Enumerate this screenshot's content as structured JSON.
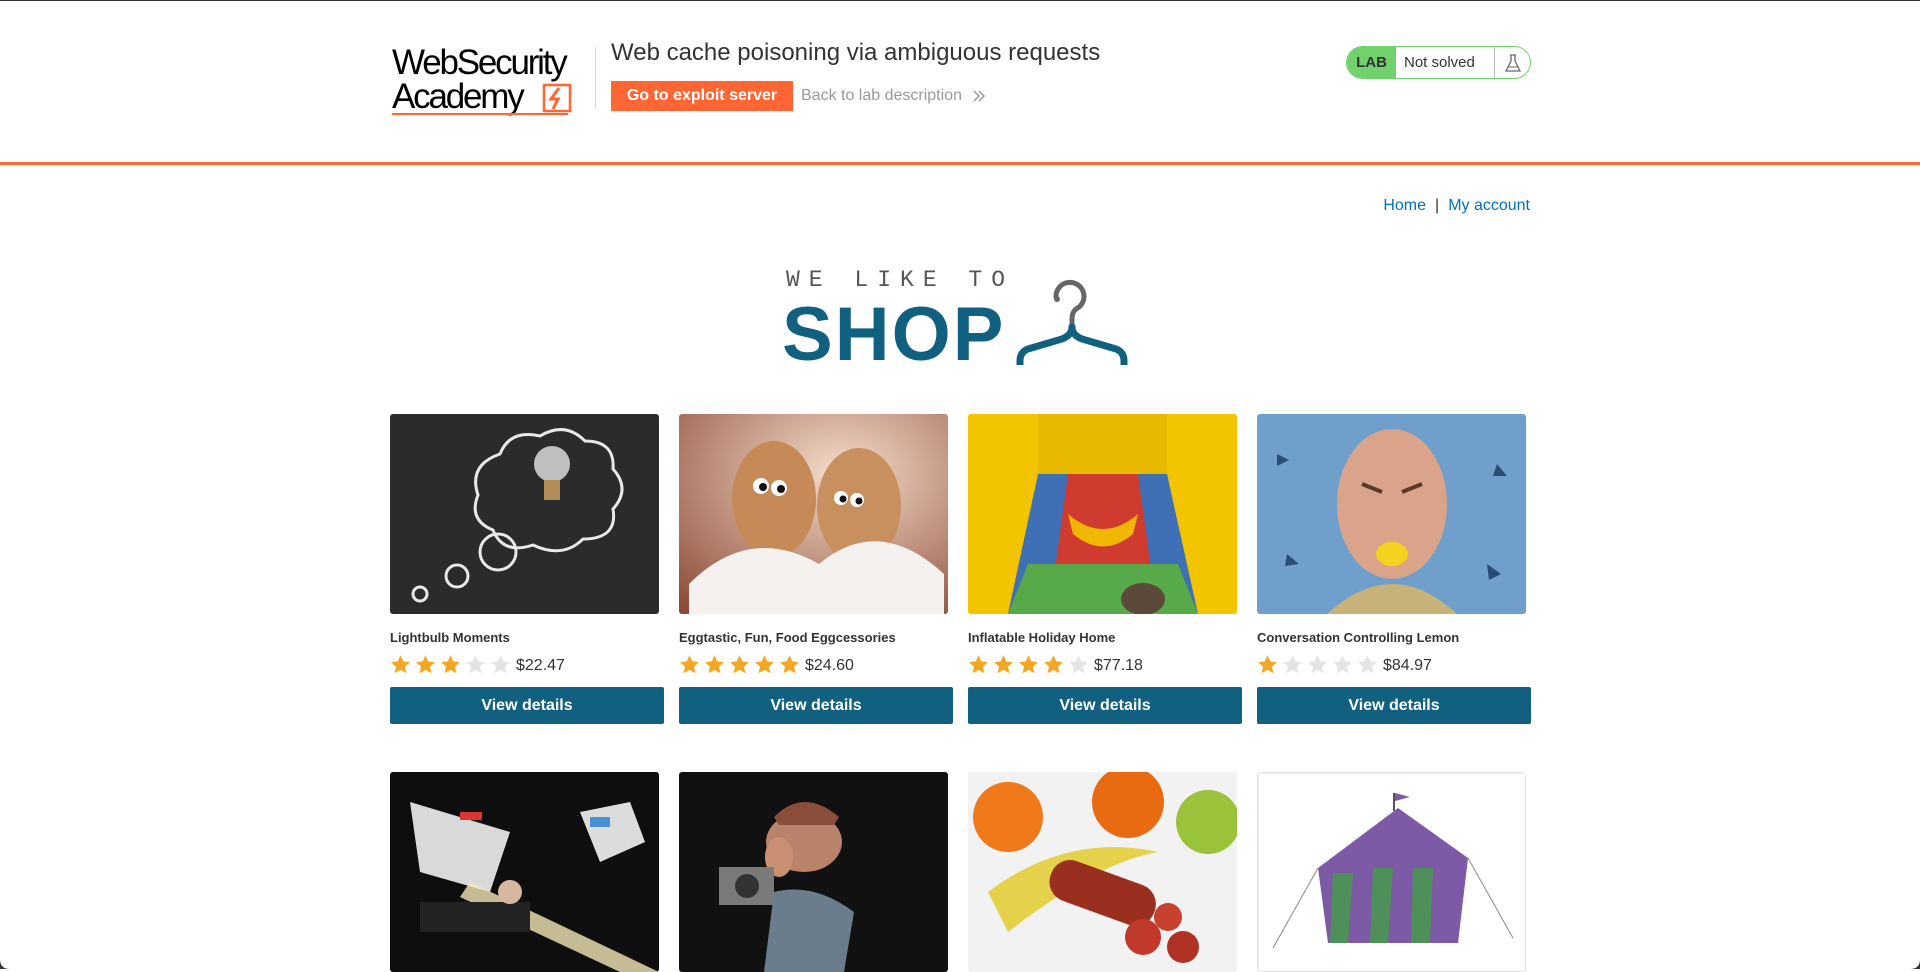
{
  "header": {
    "logo_line1": "WebSecurity",
    "logo_line2": "Academy",
    "lab_title": "Web cache poisoning via ambiguous requests",
    "exploit_button": "Go to exploit server",
    "back_link": "Back to lab description",
    "status_tag": "LAB",
    "status_text": "Not solved",
    "accent_color": "#ff6633",
    "status_color": "#70d16d"
  },
  "nav": {
    "home": "Home",
    "separator": "|",
    "account": "My account"
  },
  "banner": {
    "small_text": "WE LIKE TO",
    "big_text": "SHOP",
    "icon": "hanger-icon"
  },
  "products": [
    {
      "name": "Lightbulb Moments",
      "rating": 3,
      "price": "$22.47",
      "button": "View details",
      "image": "lightbulb-image"
    },
    {
      "name": "Eggtastic, Fun, Food Eggcessories",
      "rating": 5,
      "price": "$24.60",
      "button": "View details",
      "image": "eggs-image"
    },
    {
      "name": "Inflatable Holiday Home",
      "rating": 4,
      "price": "$77.18",
      "button": "View details",
      "image": "inflatable-image"
    },
    {
      "name": "Conversation Controlling Lemon",
      "rating": 1,
      "price": "$84.97",
      "button": "View details",
      "image": "lemon-image"
    },
    {
      "name": "",
      "rating": 0,
      "price": "",
      "button": "",
      "image": "laser-tag-image"
    },
    {
      "name": "",
      "rating": 0,
      "price": "",
      "button": "",
      "image": "photographer-image"
    },
    {
      "name": "",
      "rating": 0,
      "price": "",
      "button": "",
      "image": "fruit-sausage-image"
    },
    {
      "name": "",
      "rating": 0,
      "price": "",
      "button": "",
      "image": "tent-image"
    }
  ],
  "colors": {
    "button": "#11607f",
    "link": "#0071bc",
    "star_on": "#f5a623",
    "star_off": "#e4e4e4"
  }
}
